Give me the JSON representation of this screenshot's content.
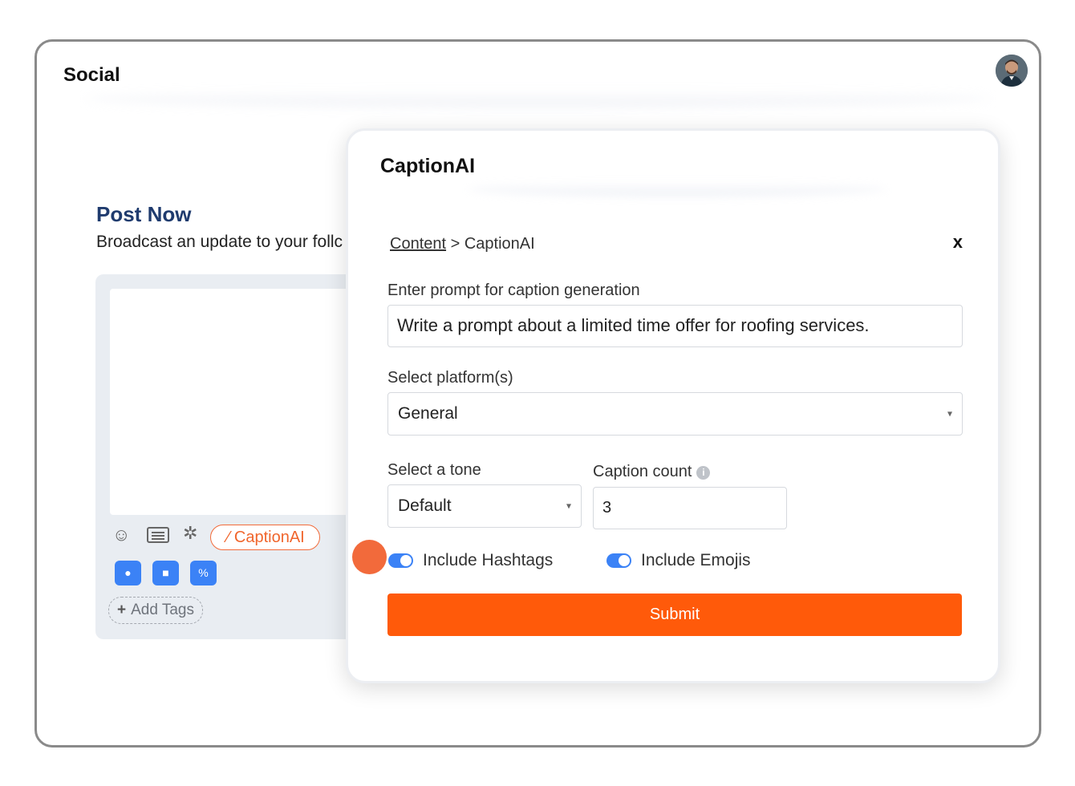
{
  "app": {
    "title": "Social"
  },
  "post": {
    "title": "Post Now",
    "subtitle": "Broadcast an update to your follc"
  },
  "composer": {
    "tools": [
      "smiley-icon",
      "list-icon",
      "gear-icon"
    ],
    "caption_chip": "CaptionAI",
    "media_buttons": [
      "camera-icon",
      "video-icon",
      "link-icon"
    ],
    "add_tags": "Add Tags"
  },
  "modal": {
    "title": "CaptionAI",
    "breadcrumb": {
      "link": "Content",
      "separator": " > ",
      "current": "CaptionAI"
    },
    "close_label": "x",
    "prompt": {
      "label": "Enter prompt for caption generation",
      "value": "Write a prompt about a limited time offer for roofing services."
    },
    "platform": {
      "label": "Select platform(s)",
      "value": "General"
    },
    "tone": {
      "label": "Select a tone",
      "value": "Default"
    },
    "caption_count": {
      "label": "Caption count",
      "value": "3"
    },
    "toggles": {
      "hashtags": {
        "label": "Include Hashtags",
        "on": true
      },
      "emojis": {
        "label": "Include Emojis",
        "on": true
      }
    },
    "submit_label": "Submit"
  },
  "colors": {
    "accent": "#ff5a0a",
    "toggle": "#3b82f6",
    "heading": "#1f3b6e"
  }
}
